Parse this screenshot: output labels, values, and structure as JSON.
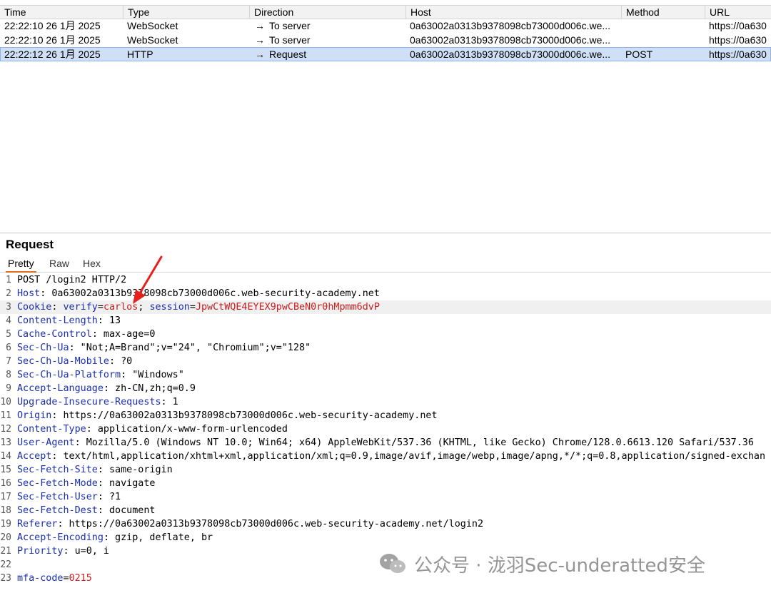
{
  "history": {
    "columns": [
      "Time",
      "Type",
      "Direction",
      "Host",
      "Method",
      "URL"
    ],
    "rows": [
      {
        "time": "22:22:10 26 1月 2025",
        "type": "WebSocket",
        "direction": "To server",
        "host": "0a63002a0313b9378098cb73000d006c.we...",
        "method": "",
        "url": "https://0a630"
      },
      {
        "time": "22:22:10 26 1月 2025",
        "type": "WebSocket",
        "direction": "To server",
        "host": "0a63002a0313b9378098cb73000d006c.we...",
        "method": "",
        "url": "https://0a630"
      },
      {
        "time": "22:22:12 26 1月 2025",
        "type": "HTTP",
        "direction": "Request",
        "host": "0a63002a0313b9378098cb73000d006c.we...",
        "method": "POST",
        "url": "https://0a630"
      }
    ],
    "selected_row": 2,
    "arrow_glyph": "→"
  },
  "request": {
    "title": "Request",
    "tabs": [
      "Pretty",
      "Raw",
      "Hex"
    ],
    "active_tab": "Pretty",
    "lines": {
      "l1": "POST /login2 HTTP/2",
      "host_k": "Host",
      "host_v": ": 0a63002a0313b9378098cb73000d006c.web-security-academy.net",
      "cookie_k": "Cookie",
      "cookie_sep": ": ",
      "verify_k": "verify",
      "verify_v": "carlos",
      "cookie_semi": "; ",
      "session_k": "session",
      "session_v": "JpwCtWQE4EYEX9pwCBeN0r0hMpmm6dvP",
      "cl_k": "Content-Length",
      "cl_v": ": 13",
      "cc_k": "Cache-Control",
      "cc_v": ": max-age=0",
      "scu_k": "Sec-Ch-Ua",
      "scu_v": ": \"Not;A=Brand\";v=\"24\", \"Chromium\";v=\"128\"",
      "scum_k": "Sec-Ch-Ua-Mobile",
      "scum_v": ": ?0",
      "scup_k": "Sec-Ch-Ua-Platform",
      "scup_v": ": \"Windows\"",
      "al_k": "Accept-Language",
      "al_v": ": zh-CN,zh;q=0.9",
      "uir_k": "Upgrade-Insecure-Requests",
      "uir_v": ": 1",
      "or_k": "Origin",
      "or_v": ": https://0a63002a0313b9378098cb73000d006c.web-security-academy.net",
      "ct_k": "Content-Type",
      "ct_v": ": application/x-www-form-urlencoded",
      "ua_k": "User-Agent",
      "ua_v": ": Mozilla/5.0 (Windows NT 10.0; Win64; x64) AppleWebKit/537.36 (KHTML, like Gecko) Chrome/128.0.6613.120 Safari/537.36",
      "ac_k": "Accept",
      "ac_v": ": text/html,application/xhtml+xml,application/xml;q=0.9,image/avif,image/webp,image/apng,*/*;q=0.8,application/signed-exchan",
      "sfs_k": "Sec-Fetch-Site",
      "sfs_v": ": same-origin",
      "sfm_k": "Sec-Fetch-Mode",
      "sfm_v": ": navigate",
      "sfu_k": "Sec-Fetch-User",
      "sfu_v": ": ?1",
      "sfd_k": "Sec-Fetch-Dest",
      "sfd_v": ": document",
      "ref_k": "Referer",
      "ref_v": ": https://0a63002a0313b9378098cb73000d006c.web-security-academy.net/login2",
      "ae_k": "Accept-Encoding",
      "ae_v": ": gzip, deflate, br",
      "pr_k": "Priority",
      "pr_v": ": u=0, i",
      "mfa_k": "mfa-code",
      "mfa_eq": "=",
      "mfa_v": "0215"
    },
    "line_numbers": [
      "1",
      "2",
      "3",
      "4",
      "5",
      "6",
      "7",
      "8",
      "9",
      "10",
      "11",
      "12",
      "13",
      "14",
      "15",
      "16",
      "17",
      "18",
      "19",
      "20",
      "21",
      "22",
      "23"
    ]
  },
  "watermark": {
    "text": "公众号 · 泷羽Sec-underatted安全"
  },
  "colors": {
    "header_key": "#1a2fb0",
    "cookie_value": "#c81e1e",
    "selected_row": "#cfe0f6",
    "tab_underline": "#e0701f",
    "annotation": "#e8201c"
  }
}
